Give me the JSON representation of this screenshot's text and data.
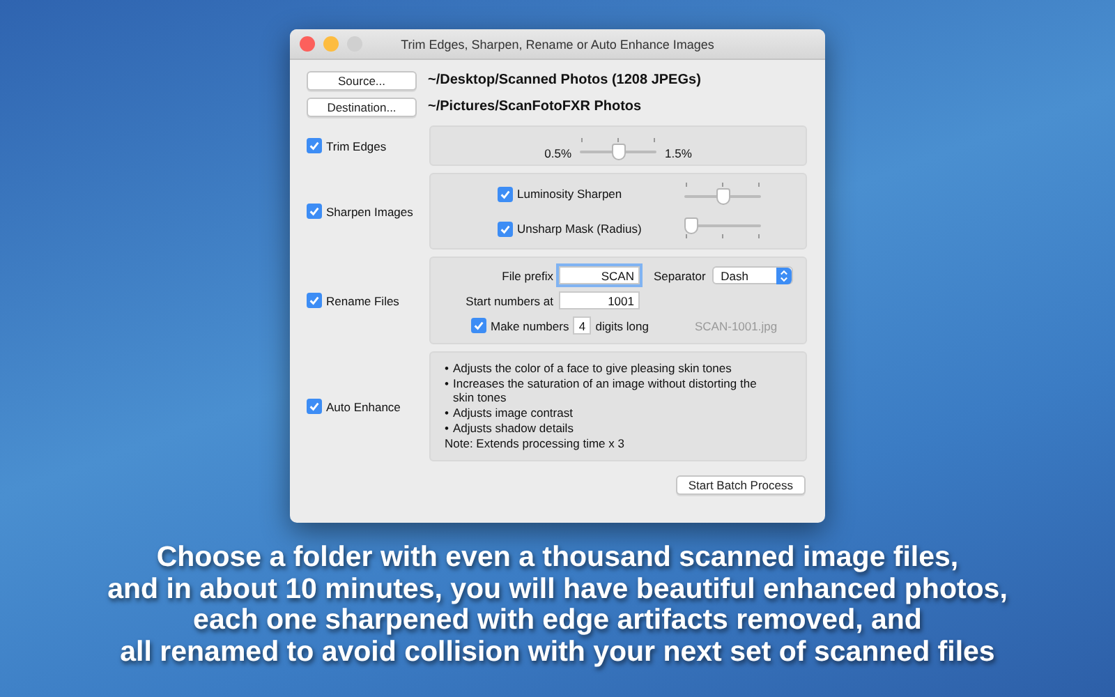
{
  "window": {
    "title": "Trim Edges, Sharpen, Rename or Auto Enhance Images"
  },
  "folders": [
    {
      "button": "Source...",
      "path": "~/Desktop/Scanned Photos (1208 JPEGs)"
    },
    {
      "button": "Destination...",
      "path": "~/Pictures/ScanFotoFXR Photos"
    }
  ],
  "sections": [
    {
      "kind": "trim",
      "label": "Trim Edges",
      "checked": true,
      "min_label": "0.5%",
      "max_label": "1.5%",
      "level": 0.5
    },
    {
      "kind": "sharpen",
      "label": "Sharpen Images",
      "checked": true,
      "options": [
        {
          "label": "Luminosity Sharpen",
          "checked": true,
          "level": 0.5
        },
        {
          "label": "Unsharp Mask (Radius)",
          "checked": true,
          "level": 0.0
        }
      ]
    },
    {
      "kind": "rename",
      "label": "Rename Files",
      "checked": true,
      "prefix_label": "File prefix",
      "prefix": "SCAN",
      "separator_label": "Separator",
      "separator": "Dash",
      "start_label": "Start numbers at",
      "start": "1001",
      "digits_checked": true,
      "digits_label": "Make numbers",
      "digits": "4",
      "digits_suffix": "digits long",
      "example": "SCAN-1001.jpg"
    },
    {
      "kind": "enhance",
      "label": "Auto Enhance",
      "checked": true,
      "bullets": [
        "Adjusts the color of a face to give pleasing skin tones",
        "Increases the saturation of an image without distorting the skin tones",
        "Adjusts image contrast",
        "Adjusts shadow details"
      ],
      "bullet_mark": "•",
      "note": "Note: Extends processing time x 3"
    }
  ],
  "start_button": "Start Batch Process",
  "caption": [
    "Choose a folder with even a thousand scanned image files,",
    "and in about 10 minutes, you will have beautiful enhanced photos,",
    "each one sharpened with edge artifacts removed, and",
    "all renamed to avoid collision with your next set of scanned files"
  ]
}
